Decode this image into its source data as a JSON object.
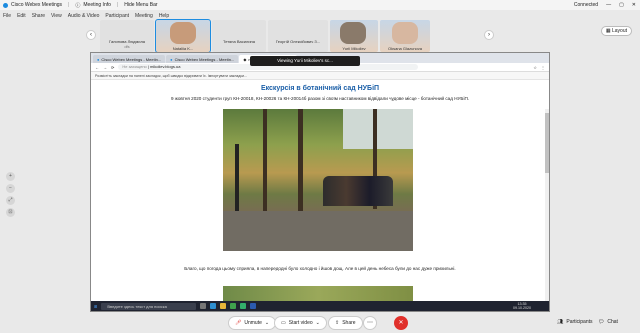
{
  "app": {
    "title": "Cisco Webex Meetings",
    "meeting_info": "Meeting Info",
    "hide_menu": "Hide Menu Bar",
    "status": "Connected"
  },
  "menu": [
    "File",
    "Edit",
    "Share",
    "View",
    "Audio & Video",
    "Participant",
    "Meeting",
    "Help"
  ],
  "participants": [
    {
      "name": "Галинова Людмила",
      "sub": "dfs"
    },
    {
      "name": "Nataliia K...",
      "sub": ""
    },
    {
      "name": "Тетяна Василина",
      "sub": ""
    },
    {
      "name": "Георгій Олексійович З...",
      "sub": ""
    },
    {
      "name": "Yurii Mikoliev",
      "sub": ""
    },
    {
      "name": "Oksana Glazunova",
      "sub": ""
    }
  ],
  "layout_label": "Layout",
  "share_banner": "Viewing Yurii Mikoliev's sc...",
  "browser": {
    "tabs": [
      "Cisco Webex Meetings - Meetin...",
      "Cisco Webex Meetings - Meetin...",
      "mikoliev.bloru.ua/sujeputi"
    ],
    "url": "mikoliev.blogs.ua",
    "security": "Не захищено",
    "infobar": "Розмістіть закладки на панелі закладок, щоб швидко відкривати їх. Імпортувати закладки..."
  },
  "article": {
    "title": "Екскурсія в ботанічний сад НУБіП",
    "intro": "9 жовтня 2020 студенти груп КН-20018, КН-20026 та КН-20014б разом зі своїм наставником відвідали чудове місце - ботанічний сад НУБіП.",
    "after": "Благо, що погода цьому сприяла, в напередодні було холодно і йшов дощ. Але в цей день небеса були до нас дуже прихильні."
  },
  "taskbar": {
    "search": "Введите здесь текст для поиска",
    "time": "13:35",
    "date": "09.10.2020"
  },
  "controls": {
    "unmute": "Unmute",
    "start_video": "Start video",
    "share": "Share",
    "participants": "Participants",
    "chat": "Chat"
  },
  "colors": {
    "accent": "#1d8ce0",
    "end": "#e0302b",
    "title": "#1b5fa8"
  }
}
